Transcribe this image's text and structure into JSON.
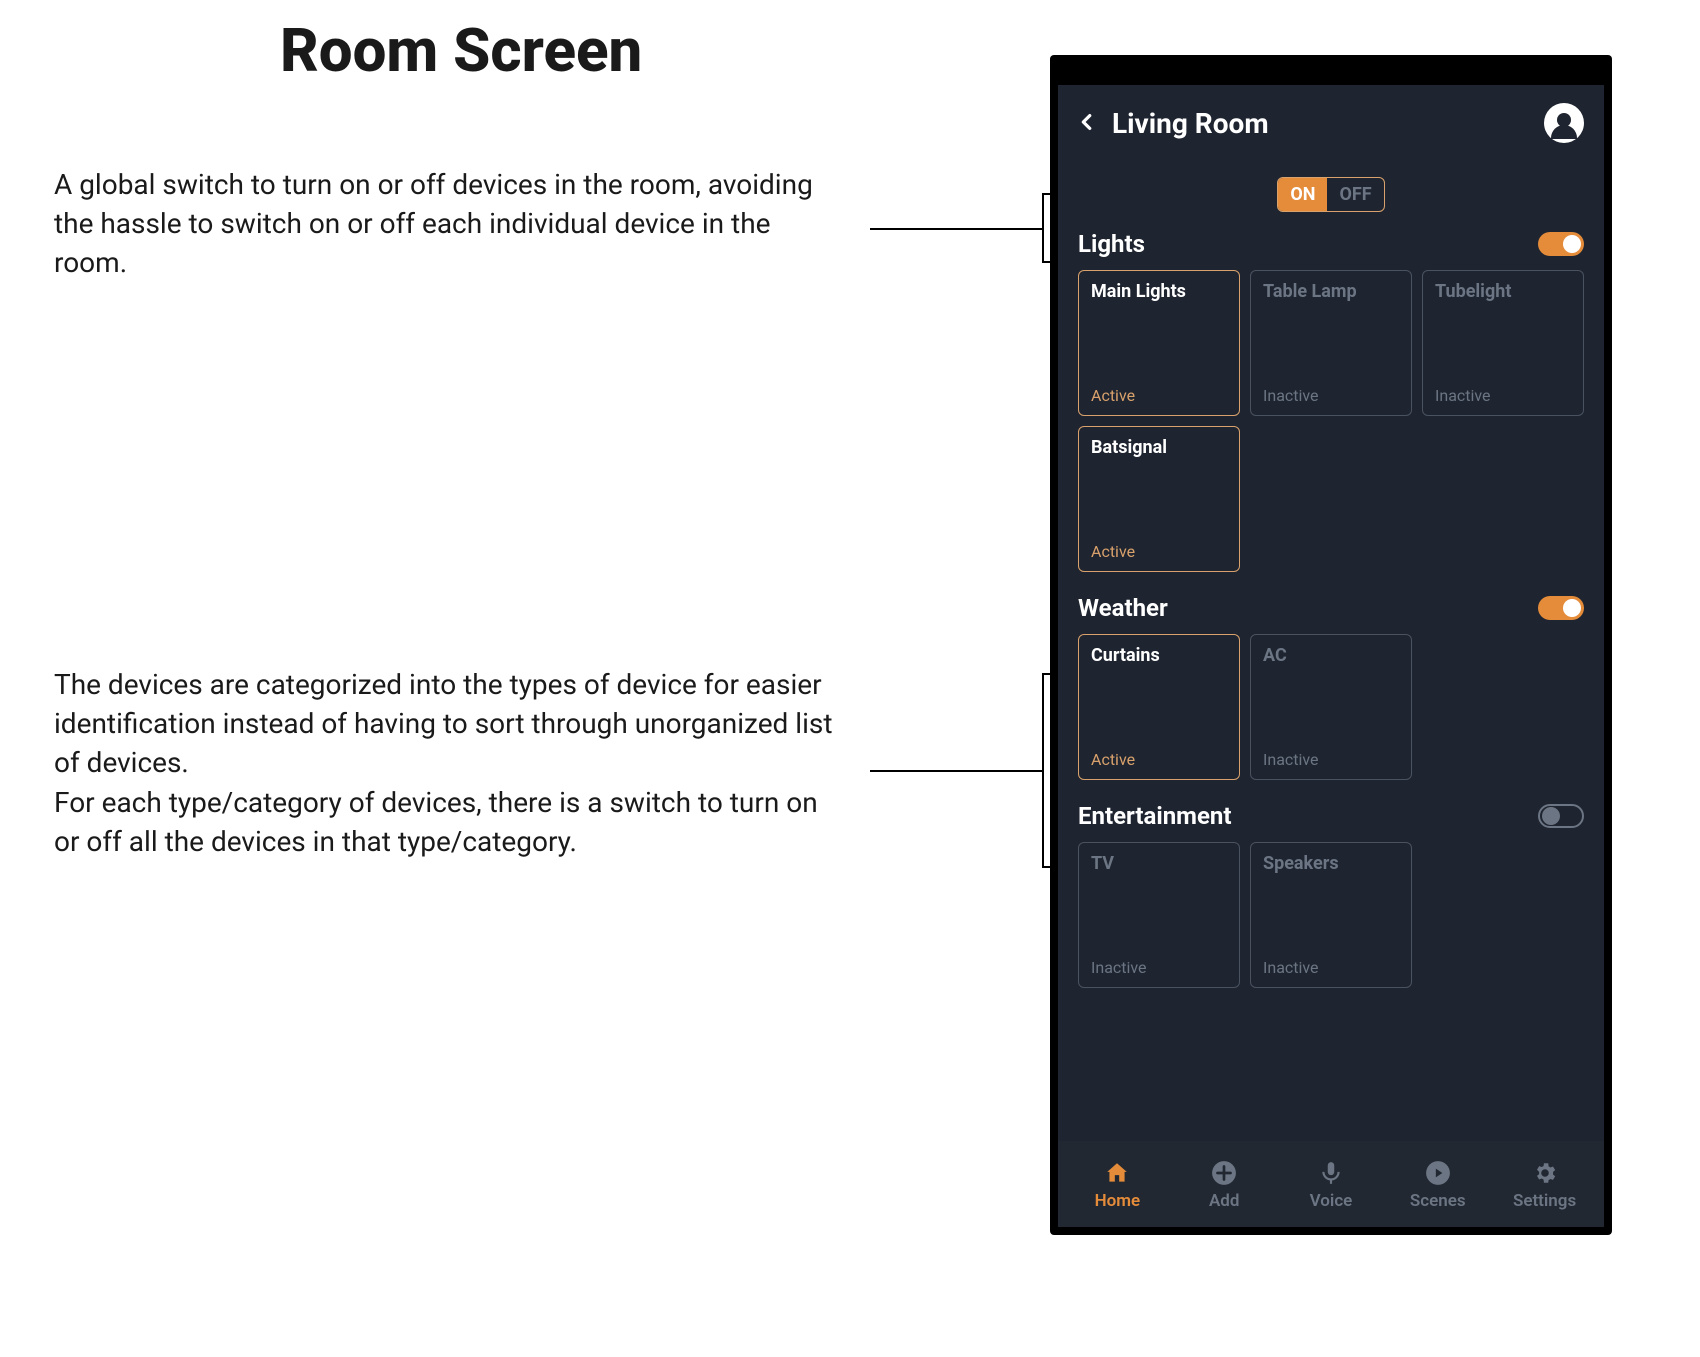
{
  "page_title": "Room Screen",
  "annotations": {
    "global_switch": "A global switch to turn on or off devices in the room, avoiding the hassle to switch on or off each individual device in the room.",
    "categories": "The devices are categorized into the types of device for easier identification instead of having to sort through unorganized list of devices.\nFor each type/category of devices, there is a switch to turn on or off all the devices in that type/category."
  },
  "room": {
    "title": "Living Room",
    "global_switch": {
      "on_label": "ON",
      "off_label": "OFF",
      "state": "on"
    }
  },
  "status_labels": {
    "active": "Active",
    "inactive": "Inactive"
  },
  "sections": [
    {
      "title": "Lights",
      "toggle_on": true,
      "devices": [
        {
          "name": "Main Lights",
          "active": true
        },
        {
          "name": "Table Lamp",
          "active": false
        },
        {
          "name": "Tubelight",
          "active": false
        },
        {
          "name": "Batsignal",
          "active": true
        }
      ]
    },
    {
      "title": "Weather",
      "toggle_on": true,
      "devices": [
        {
          "name": "Curtains",
          "active": true
        },
        {
          "name": "AC",
          "active": false
        }
      ]
    },
    {
      "title": "Entertainment",
      "toggle_on": false,
      "devices": [
        {
          "name": "TV",
          "active": false
        },
        {
          "name": "Speakers",
          "active": false
        }
      ]
    }
  ],
  "nav": [
    {
      "label": "Home",
      "icon": "home",
      "active": true
    },
    {
      "label": "Add",
      "icon": "add",
      "active": false
    },
    {
      "label": "Voice",
      "icon": "mic",
      "active": false
    },
    {
      "label": "Scenes",
      "icon": "play",
      "active": false
    },
    {
      "label": "Settings",
      "icon": "gear",
      "active": false
    }
  ]
}
